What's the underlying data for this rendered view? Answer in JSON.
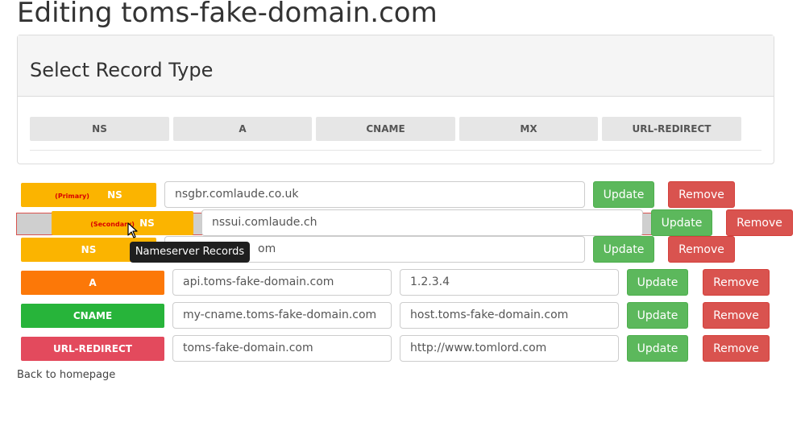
{
  "page": {
    "title": "Editing toms-fake-domain.com"
  },
  "select_panel": {
    "title": "Select Record Type",
    "types": [
      {
        "label": "NS"
      },
      {
        "label": "A"
      },
      {
        "label": "CNAME"
      },
      {
        "label": "MX"
      },
      {
        "label": "URL-REDIRECT"
      }
    ]
  },
  "records": [
    {
      "type": "NS",
      "tag": "(Primary)",
      "value": "nsgbr.comlaude.co.uk"
    },
    {
      "type": "NS",
      "tag": "(Secondary)",
      "value": "nssui.comlaude.ch"
    },
    {
      "type": "NS",
      "value": "om"
    },
    {
      "type": "A",
      "host": "api.toms-fake-domain.com",
      "value": "1.2.3.4"
    },
    {
      "type": "CNAME",
      "host": "my-cname.toms-fake-domain.com",
      "value": "host.toms-fake-domain.com"
    },
    {
      "type": "URL-REDIRECT",
      "host": "toms-fake-domain.com",
      "value": "http://www.tomlord.com"
    }
  ],
  "buttons": {
    "update": "Update",
    "remove": "Remove"
  },
  "tooltip": {
    "text": "Nameserver Records"
  },
  "footer": {
    "back_link": "Back to homepage"
  },
  "colors": {
    "ns": "#fbb400",
    "a": "#fc7808",
    "cname": "#27b43a",
    "url_redirect": "#e34a5d",
    "update": "#5cb85c",
    "remove": "#d9534f"
  }
}
